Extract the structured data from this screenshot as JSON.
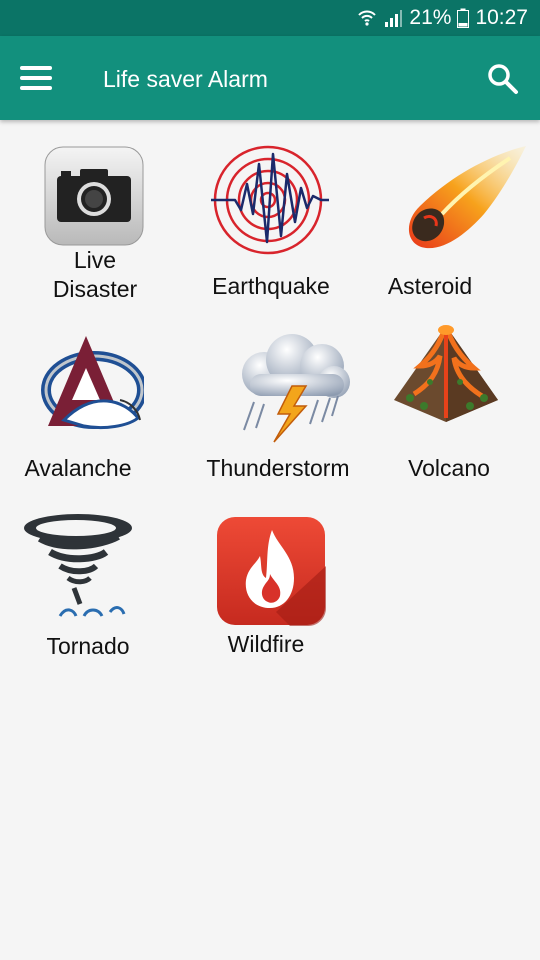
{
  "status_bar": {
    "battery_percent": "21%",
    "time": "10:27",
    "icons": [
      "wifi-icon",
      "signal-icon",
      "battery-icon"
    ]
  },
  "app_bar": {
    "title": "Life saver Alarm",
    "menu_icon": "hamburger-menu-icon",
    "search_icon": "search-icon"
  },
  "tiles": [
    {
      "label": "Live\nDisaster",
      "icon": "camera-icon"
    },
    {
      "label": "Earthquake",
      "icon": "seismograph-icon"
    },
    {
      "label": "Asteroid",
      "icon": "meteor-icon"
    },
    {
      "label": "Avalanche",
      "icon": "avalanche-logo-icon"
    },
    {
      "label": "Thunderstorm",
      "icon": "thunderstorm-icon"
    },
    {
      "label": "Volcano",
      "icon": "volcano-icon"
    },
    {
      "label": "Tornado",
      "icon": "tornado-icon"
    },
    {
      "label": "Wildfire",
      "icon": "fire-icon"
    }
  ],
  "colors": {
    "status_bar": "#0b7466",
    "app_bar": "#12907d",
    "background": "#f5f5f5"
  }
}
